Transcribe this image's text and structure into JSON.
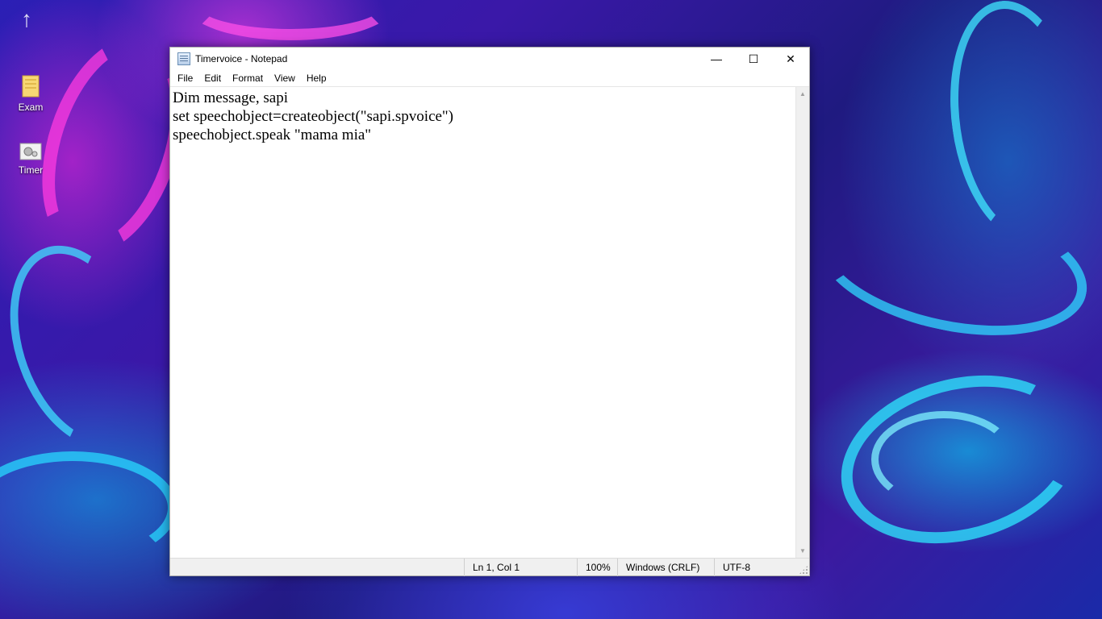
{
  "desktop": {
    "icons": [
      {
        "label": "Exam",
        "icon": "folder-icon"
      },
      {
        "label": "Timer",
        "icon": "script-file-icon"
      }
    ]
  },
  "window": {
    "title": "Timervoice - Notepad",
    "controls": {
      "minimize": "—",
      "maximize": "☐",
      "close": "✕"
    }
  },
  "menu": [
    "File",
    "Edit",
    "Format",
    "View",
    "Help"
  ],
  "editor": {
    "lines": [
      "Dim message, sapi",
      "set speechobject=createobject(\"sapi.spvoice\")",
      "speechobject.speak \"mama mia\""
    ]
  },
  "statusbar": {
    "position": "Ln 1, Col 1",
    "zoom": "100%",
    "line_ending": "Windows (CRLF)",
    "encoding": "UTF-8"
  },
  "colors": {
    "wallpaper_base": "#2b1fb5",
    "wallpaper_cyan": "#00e6ff",
    "wallpaper_magenta": "#ff28dc"
  }
}
